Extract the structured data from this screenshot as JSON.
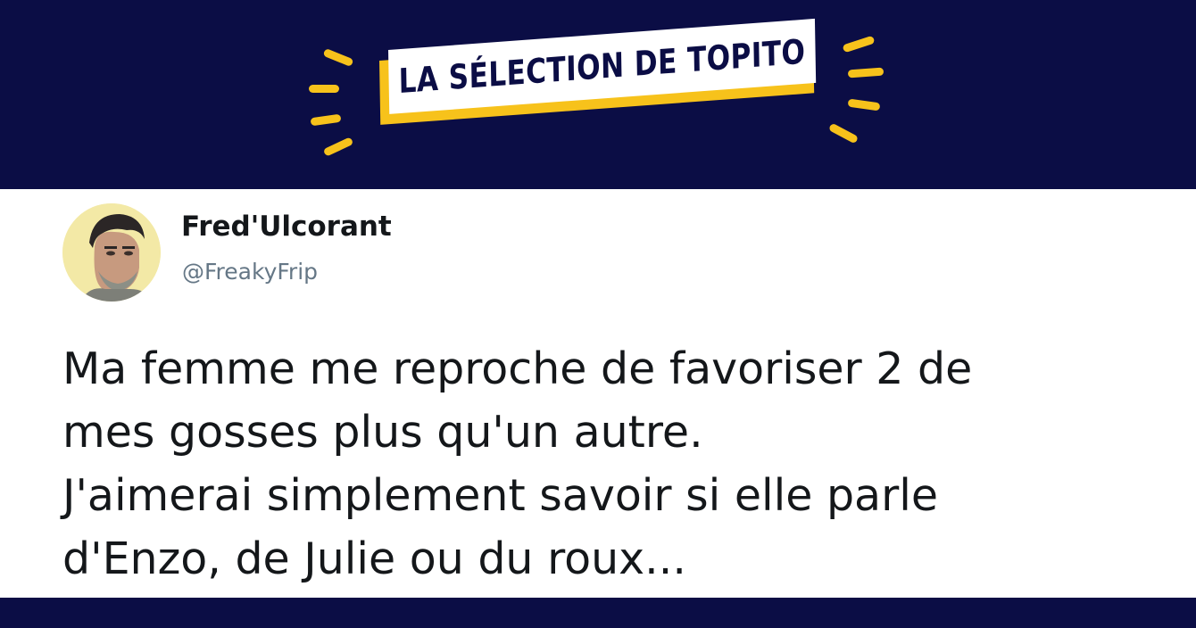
{
  "header": {
    "banner_text": "LA SÉLECTION DE TOPITO",
    "background_color": "#0b0d45",
    "accent_color": "#f7c21b"
  },
  "tweet": {
    "author_name": "Fred'Ulcorant",
    "author_handle": "@FreakyFrip",
    "avatar_icon": "avatar-cartoon-face",
    "lines": [
      "Ma femme me reproche de favoriser 2 de",
      "mes gosses plus qu'un autre.",
      "J'aimerai simplement savoir si elle parle",
      "d'Enzo, de Julie ou du roux..."
    ]
  }
}
